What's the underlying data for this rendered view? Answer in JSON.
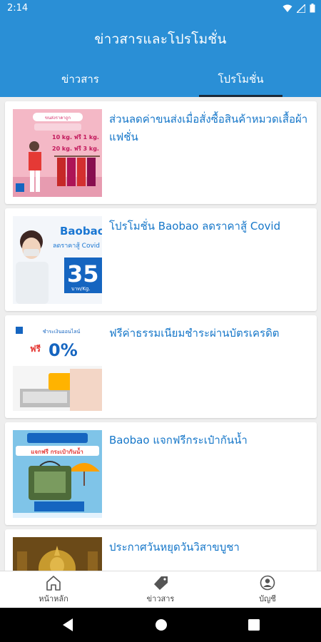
{
  "status": {
    "time": "2:14"
  },
  "header": {
    "title": "ข่าวสารและโปรโมชั่น"
  },
  "tabs": [
    {
      "label": "ข่าวสาร",
      "active": false
    },
    {
      "label": "โปรโมชั่น",
      "active": true
    }
  ],
  "promotions": [
    {
      "title": "ส่วนลดค่าขนส่งเมื่อสั่งซื้อสินค้าหมวดเสื้อผ้าแฟชั่น",
      "image": {
        "banner": "ขนส่งราคาถูก",
        "line1": "10 kg. ฟรี 1 kg.",
        "line2": "20 kg. ฟรี 3 kg."
      }
    },
    {
      "title": "โปรโมชั่น  Baobao ลดราคาสู้ Covid",
      "image": {
        "brand": "Baobao",
        "sub": "ลดราคาสู้ Covid",
        "price": "35",
        "unit": "บาท/Kg."
      }
    },
    {
      "title": "ฟรีค่าธรรมเนียมชำระผ่านบัตรเครดิต",
      "image": {
        "heading": "ชำระเงินออนไลน์",
        "free": "ฟรี",
        "percent": "0%"
      }
    },
    {
      "title": "Baobao แจกฟรีกระเป๋ากันน้ำ",
      "image": {
        "heading": "แจกฟรี กระเป๋ากันน้ำ"
      }
    },
    {
      "title": "ประกาศวันหยุดวันวิสาขบูชา",
      "image": {}
    }
  ],
  "bottom_nav": [
    {
      "label": "หน้าหลัก",
      "icon": "home-icon"
    },
    {
      "label": "ข่าวสาร",
      "icon": "tag-icon"
    },
    {
      "label": "บัญชี",
      "icon": "account-icon"
    }
  ],
  "colors": {
    "primary": "#2a8fd6",
    "title_text": "#1677c9",
    "tab_indicator": "#1b2a3a"
  }
}
